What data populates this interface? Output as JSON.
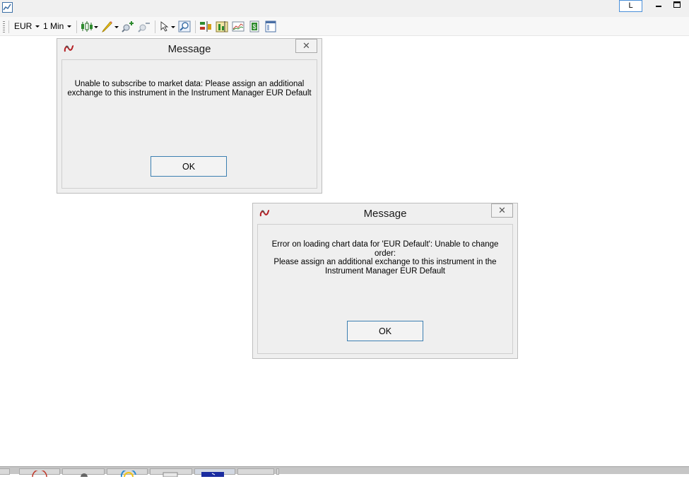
{
  "titlebar": {
    "instrument_box": "L",
    "app_icon": "line-chart-icon",
    "minimize_icon": "minimize-icon",
    "maximize_icon": "maximize-icon"
  },
  "toolbar": {
    "instrument": "EUR",
    "interval": "1 Min",
    "icons": [
      "candlestick-chart-style-icon",
      "drawing-pencil-icon",
      "zoom-in-icon",
      "zoom-out-icon",
      "cursor-pointer-icon",
      "magnifier-icon",
      "bar-split-icon",
      "data-box-icon",
      "chart-panel-icon",
      "dollar-icon",
      "template-icon"
    ]
  },
  "dialogs": [
    {
      "title": "Message",
      "message_lines": [
        "Unable to subscribe to market data: Please assign an additional",
        "exchange to this instrument in the Instrument Manager EUR Default"
      ],
      "ok_label": "OK",
      "close_label": "✕"
    },
    {
      "title": "Message",
      "message_lines": [
        "Error on loading chart data for 'EUR Default': Unable to change order:",
        "Please assign an additional exchange to this instrument in the",
        "Instrument Manager EUR Default"
      ],
      "ok_label": "OK",
      "close_label": "✕"
    }
  ],
  "colors": {
    "accent_blue": "#3c7fb1",
    "dialog_bg": "#efefef",
    "logo_red": "#b51f24"
  }
}
